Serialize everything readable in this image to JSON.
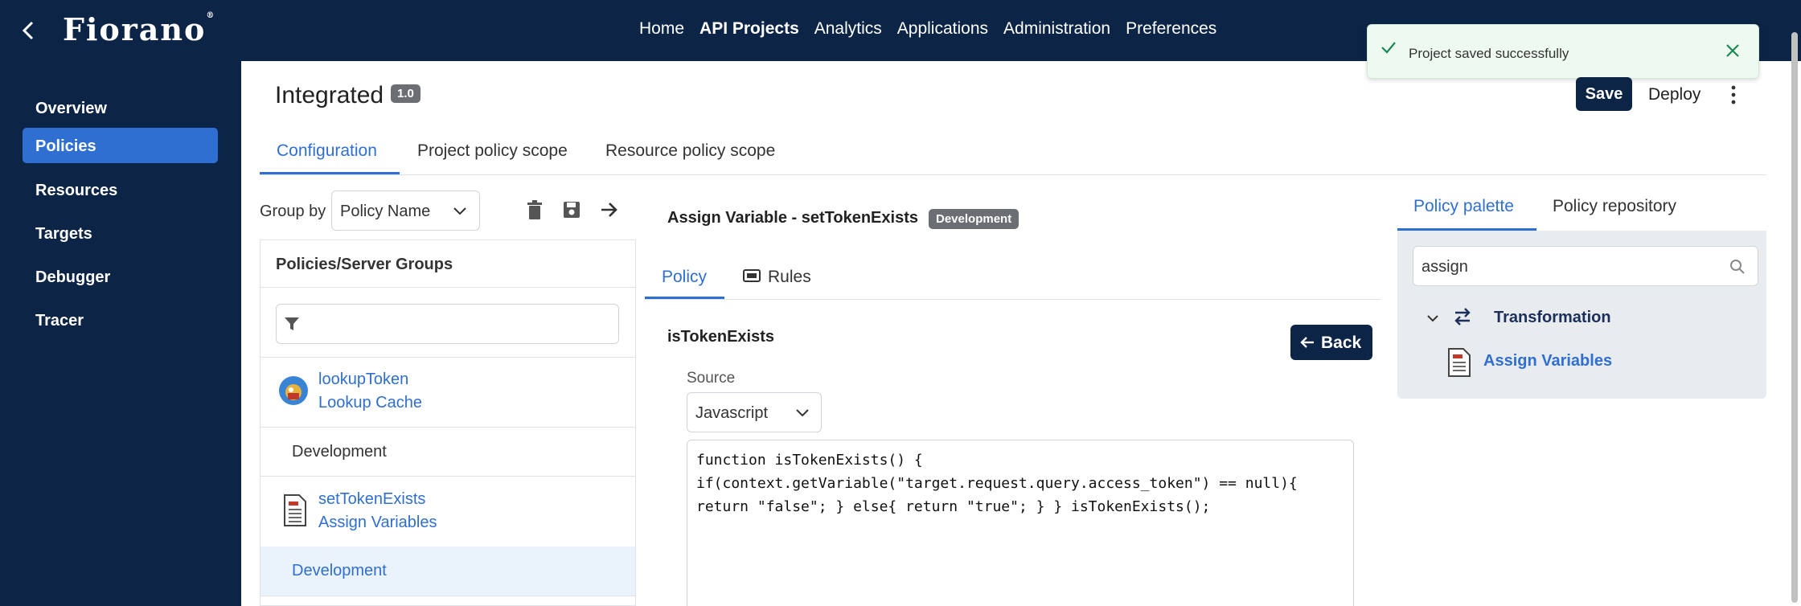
{
  "topbar": {
    "logo": "Fiorano",
    "nav": [
      "Home",
      "API Projects",
      "Analytics",
      "Applications",
      "Administration",
      "Preferences"
    ],
    "active_nav": "API Projects"
  },
  "toast": {
    "message": "Project saved successfully",
    "color": "#198754"
  },
  "sidebar": {
    "items": [
      {
        "label": "Overview"
      },
      {
        "label": "Policies"
      },
      {
        "label": "Resources"
      },
      {
        "label": "Targets"
      },
      {
        "label": "Debugger"
      },
      {
        "label": "Tracer"
      }
    ],
    "active": "Policies"
  },
  "header": {
    "title": "Integrated",
    "version": "1.0",
    "save_label": "Save",
    "deploy_label": "Deploy"
  },
  "tabs": [
    "Configuration",
    "Project policy scope",
    "Resource policy scope"
  ],
  "groupby": {
    "label": "Group by",
    "value": "Policy Name"
  },
  "policy_panel": {
    "title": "Policies/Server Groups",
    "filter_placeholder": "",
    "entries": [
      {
        "name": "lookupToken",
        "type": "Lookup Cache",
        "env": "Development",
        "icon": "lookup-cache-icon"
      },
      {
        "name": "setTokenExists",
        "type": "Assign Variables",
        "env": "Development",
        "icon": "assign-variables-icon"
      }
    ]
  },
  "center": {
    "title": "Assign Variable - setTokenExists",
    "badge": "Development",
    "subtabs": [
      "Policy",
      "Rules"
    ],
    "function_name": "isTokenExists",
    "back_label": "Back",
    "source_label": "Source",
    "source_value": "Javascript",
    "code_lines": [
      "function isTokenExists() {",
      "if(context.getVariable(\"target.request.query.access_token\") == null){",
      "return \"false\"; } else{ return \"true\"; } } isTokenExists();"
    ]
  },
  "palette": {
    "tabs": [
      "Policy palette",
      "Policy repository"
    ],
    "search_value": "assign",
    "group": "Transformation",
    "item": "Assign Variables"
  },
  "colors": {
    "navy": "#0c2547",
    "accent": "#2f6fd1"
  }
}
